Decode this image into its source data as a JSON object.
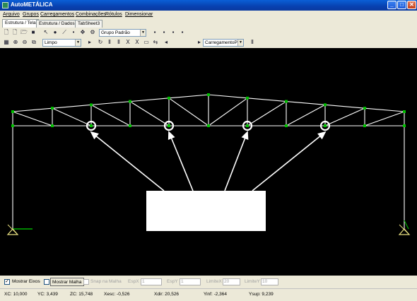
{
  "window": {
    "title": "AutoMETÁLICA"
  },
  "menu": [
    "Arquivo",
    "Grupos",
    "Carregamentos",
    "Combinações",
    "Rótulos",
    "Dimensionar"
  ],
  "tabs": [
    "Estrutura / Tela",
    "Estrutura / Dados",
    "TabSheet3"
  ],
  "toolbar1": {
    "group_combo": "Grupo Padrão"
  },
  "toolbar2": {
    "view_combo": "Limpo",
    "load_combo": "CarregamentoP"
  },
  "bottom_options": {
    "show_axes": "Mostrar Eixos",
    "show_axes_checked": true,
    "show_mesh": "Mostrar Malha",
    "show_mesh_checked": false,
    "snap_mesh": "Snap na Malha",
    "snap_mesh_checked": false,
    "espx_label": "EspX",
    "espx_value": "1",
    "espy_label": "EspY",
    "espy_value": "1",
    "limx_label": "LimiteX",
    "limx_value": "20",
    "limy_label": "LimiteY",
    "limy_value": "10"
  },
  "status": {
    "xc": "XC: 10,000",
    "yc": "YC: 3,439",
    "zc": "ZC: 15,748",
    "xesc": "Xesc: -0,526",
    "xdir": "Xdir: 20,526",
    "yinf": "Yinf: -2,364",
    "ysup": "Ysup: 9,239"
  },
  "colors": {
    "canvas_bg": "#000000",
    "member": "#ffffff",
    "node": "#00c000",
    "axis_x": "#00b000",
    "support": "#e8e080"
  }
}
